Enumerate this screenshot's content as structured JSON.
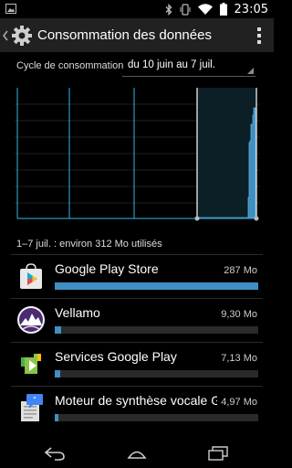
{
  "status_bar": {
    "time": "23:05"
  },
  "action_bar": {
    "title": "Consommation des données"
  },
  "cycle": {
    "label": "Cycle de consommation",
    "value": "du 10 juin au 7 juil."
  },
  "summary": "1–7 juil. : environ 312 Mo utilisés",
  "apps": [
    {
      "name": "Google Play Store",
      "amount": "287 Mo",
      "fraction": 1.0,
      "icon": "google-play-store-icon"
    },
    {
      "name": "Vellamo",
      "amount": "9,30 Mo",
      "fraction": 0.032,
      "icon": "vellamo-icon"
    },
    {
      "name": "Services Google Play",
      "amount": "7,13 Mo",
      "fraction": 0.025,
      "icon": "google-play-services-icon"
    },
    {
      "name": "Moteur de synthèse vocale Google",
      "amount": "4,97 Mo",
      "fraction": 0.017,
      "icon": "text-to-speech-icon"
    }
  ],
  "colors": {
    "accent": "#33b5e5",
    "bar": "#3f8fc4",
    "action_bar": "#212121"
  }
}
